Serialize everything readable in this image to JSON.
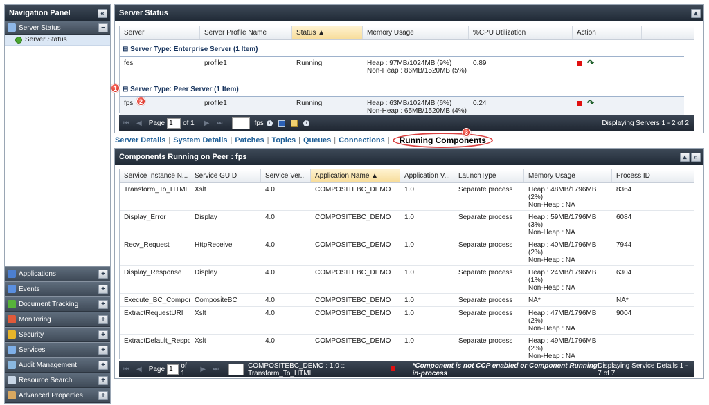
{
  "nav": {
    "title": "Navigation Panel",
    "server_status_section": "Server Status",
    "server_status_item": "Server Status",
    "bottom_sections": [
      {
        "label": "Applications",
        "icon": "applications-icon",
        "color": "#4c7fd0"
      },
      {
        "label": "Events",
        "icon": "events-icon",
        "color": "#5a8fe0"
      },
      {
        "label": "Document Tracking",
        "icon": "document-tracking-icon",
        "color": "#57b33a"
      },
      {
        "label": "Monitoring",
        "icon": "monitoring-icon",
        "color": "#e05a3a"
      },
      {
        "label": "Security",
        "icon": "security-icon",
        "color": "#e8b52a"
      },
      {
        "label": "Services",
        "icon": "services-icon",
        "color": "#7fb0e8"
      },
      {
        "label": "Audit Management",
        "icon": "audit-management-icon",
        "color": "#8ab8e0"
      },
      {
        "label": "Resource Search",
        "icon": "resource-search-icon",
        "color": "#c8d6e6"
      },
      {
        "label": "Advanced Properties",
        "icon": "advanced-properties-icon",
        "color": "#d9a860"
      }
    ]
  },
  "server_status": {
    "title": "Server Status",
    "columns": [
      "Server",
      "Server Profile Name",
      "Status ▲",
      "Memory Usage",
      "%CPU Utilization",
      "Action"
    ],
    "group1": "Server Type: Enterprise Server (1 Item)",
    "row1": {
      "server": "fes",
      "profile": "profile1",
      "status": "Running",
      "mem1": "Heap : 97MB/1024MB (9%)",
      "mem2": "Non-Heap : 86MB/1520MB (5%)",
      "cpu": "0.89"
    },
    "group2": "Server Type: Peer Server (1 Item)",
    "row2": {
      "server": "fps",
      "profile": "profile1",
      "status": "Running",
      "mem1": "Heap : 63MB/1024MB (6%)",
      "mem2": "Non-Heap : 65MB/1520MB (4%)",
      "cpu": "0.24"
    },
    "pager": {
      "page_label": "Page",
      "page_value": "1",
      "of_label": "of 1",
      "fps_label": "fps",
      "display_text": "Displaying Servers 1 - 2 of 2"
    }
  },
  "tabs": [
    "Server Details",
    "System Details",
    "Patches",
    "Topics",
    "Queues",
    "Connections",
    "Running Components"
  ],
  "callouts": [
    "1",
    "2",
    "3"
  ],
  "components": {
    "title": "Components Running on Peer : fps",
    "columns": [
      "Service Instance N...",
      "Service GUID",
      "Service Ver...",
      "Application Name ▲",
      "Application V...",
      "LaunchType",
      "Memory Usage",
      "Process ID"
    ],
    "rows": [
      {
        "name": "Transform_To_HTML",
        "guid": "Xslt",
        "ver": "4.0",
        "app": "COMPOSITEBC_DEMO",
        "appv": "1.0",
        "launch": "Separate process",
        "mem": [
          "Heap : 48MB/1796MB",
          "(2%)",
          "Non-Heap : NA"
        ],
        "pid": "8364"
      },
      {
        "name": "Display_Error",
        "guid": "Display",
        "ver": "4.0",
        "app": "COMPOSITEBC_DEMO",
        "appv": "1.0",
        "launch": "Separate process",
        "mem": [
          "Heap : 59MB/1796MB",
          "(3%)",
          "Non-Heap : NA"
        ],
        "pid": "6084"
      },
      {
        "name": "Recv_Request",
        "guid": "HttpReceive",
        "ver": "4.0",
        "app": "COMPOSITEBC_DEMO",
        "appv": "1.0",
        "launch": "Separate process",
        "mem": [
          "Heap : 40MB/1796MB",
          "(2%)",
          "Non-Heap : NA"
        ],
        "pid": "7944"
      },
      {
        "name": "Display_Response",
        "guid": "Display",
        "ver": "4.0",
        "app": "COMPOSITEBC_DEMO",
        "appv": "1.0",
        "launch": "Separate process",
        "mem": [
          "Heap : 24MB/1796MB",
          "(1%)",
          "Non-Heap : NA"
        ],
        "pid": "6304"
      },
      {
        "name": "Execute_BC_Compon",
        "guid": "CompositeBC",
        "ver": "4.0",
        "app": "COMPOSITEBC_DEMO",
        "appv": "1.0",
        "launch": "Separate process",
        "mem": [
          "NA*"
        ],
        "pid": "NA*"
      },
      {
        "name": "ExtractRequestURI",
        "guid": "Xslt",
        "ver": "4.0",
        "app": "COMPOSITEBC_DEMO",
        "appv": "1.0",
        "launch": "Separate process",
        "mem": [
          "Heap : 47MB/1796MB",
          "(2%)",
          "Non-Heap : NA"
        ],
        "pid": "9004"
      },
      {
        "name": "ExtractDefault_Respo",
        "guid": "Xslt",
        "ver": "4.0",
        "app": "COMPOSITEBC_DEMO",
        "appv": "1.0",
        "launch": "Separate process",
        "mem": [
          "Heap : 49MB/1796MB",
          "(2%)",
          "Non-Heap : NA"
        ],
        "pid": ""
      }
    ],
    "pager": {
      "page_label": "Page",
      "page_value": "1",
      "of_label": "of 1",
      "selection": "COMPOSITEBC_DEMO : 1.0 :: Transform_To_HTML",
      "note": "*Component is not CCP enabled or Component Running in-process",
      "display_text": "Displaying Service Details 1 - 7 of 7"
    }
  }
}
